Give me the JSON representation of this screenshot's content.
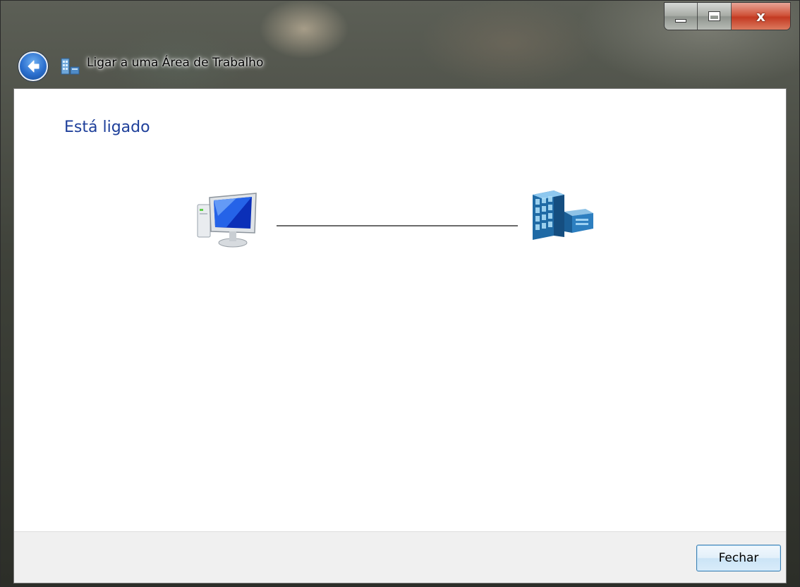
{
  "window": {
    "title": "Ligar a uma Área de Trabalho",
    "caption_buttons": {
      "minimize_icon": "minimize-icon",
      "maximize_icon": "maximize-icon",
      "close_glyph": "x"
    }
  },
  "main": {
    "heading": "Está ligado",
    "diagram": {
      "left_icon": "computer-icon",
      "right_icon": "office-building-icon",
      "status": "connected"
    }
  },
  "footer": {
    "close_button_label": "Fechar"
  },
  "colors": {
    "heading": "#1e3f9a",
    "button_border": "#3c7fb1",
    "close_caption_button": "#c33a22",
    "footer_background": "#f0f0f0"
  }
}
